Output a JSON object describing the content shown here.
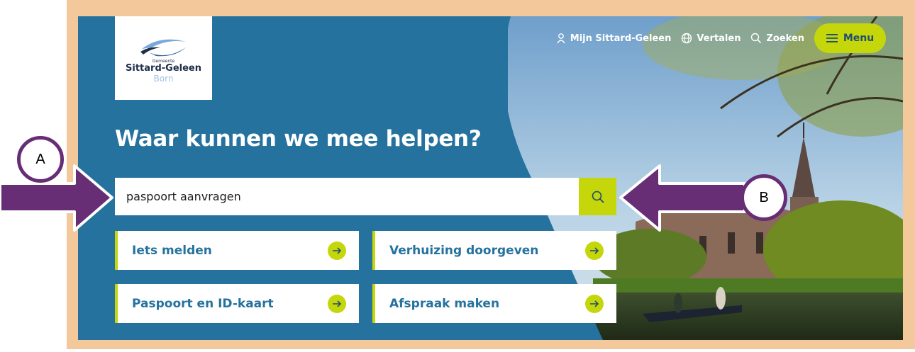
{
  "logo": {
    "small_text": "Gemeente",
    "name": "Sittard-Geleen",
    "sub": "Born"
  },
  "nav": {
    "account_label": "Mijn Sittard-Geleen",
    "translate_label": "Vertalen",
    "search_label": "Zoeken",
    "menu_label": "Menu"
  },
  "headline": "Waar kunnen we mee helpen?",
  "search": {
    "value": "paspoort aanvragen"
  },
  "tiles": [
    {
      "label": "Iets melden"
    },
    {
      "label": "Verhuizing doorgeven"
    },
    {
      "label": "Paspoort en ID-kaart"
    },
    {
      "label": "Afspraak maken"
    }
  ],
  "callouts": {
    "a": "A",
    "b": "B"
  },
  "colors": {
    "brand_blue": "#25729f",
    "accent_lime": "#c5d70a",
    "annotation_purple": "#672e75",
    "frame_tan": "#f3c99c"
  }
}
